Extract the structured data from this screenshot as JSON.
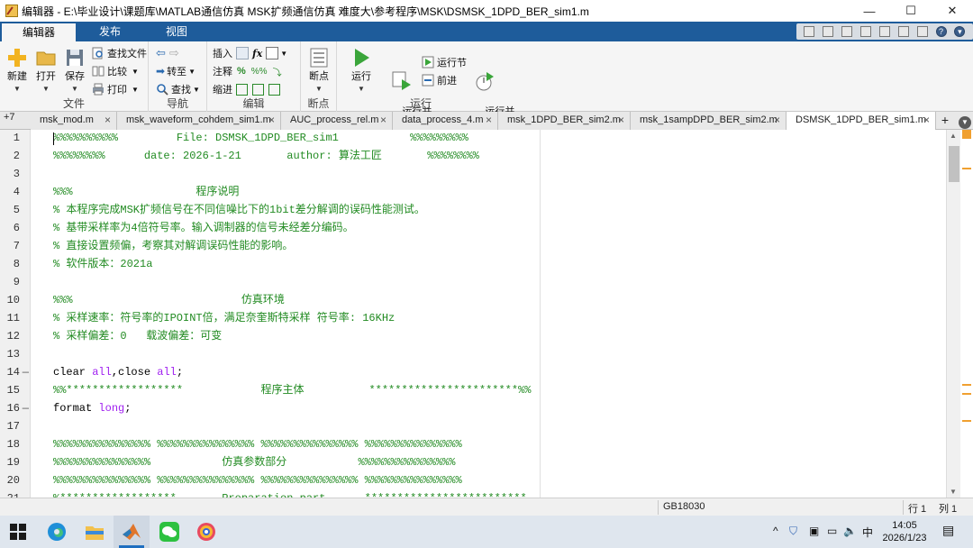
{
  "window": {
    "title": "编辑器 - E:\\毕业设计\\课题库\\MATLAB通信仿真 MSK扩频通信仿真 难度大\\参考程序\\MSK\\DSMSK_1DPD_BER_sim1.m",
    "minimize": "—",
    "maximize": "☐",
    "close": "✕"
  },
  "ribbon_tabs": [
    "编辑器",
    "发布",
    "视图"
  ],
  "ribbon": {
    "file": {
      "new": "新建",
      "open": "打开",
      "save": "保存",
      "find_files": "查找文件",
      "compare": "比较",
      "print": "打印",
      "label": "文件"
    },
    "navigate": {
      "goto": "转至",
      "find": "查找",
      "label": "导航"
    },
    "edit": {
      "insert": "插入",
      "comment": "注释",
      "indent": "缩进",
      "label": "编辑"
    },
    "breakpoints": {
      "button": "断点",
      "label": "断点"
    },
    "run": {
      "run": "运行",
      "run_advance": "运行并\n前进",
      "run_section": "运行节",
      "advance": "前进",
      "run_time": "运行并\n计时",
      "label": "运行"
    }
  },
  "doc_tabs": {
    "overflow": "+7",
    "tabs": [
      "msk_mod.m",
      "msk_waveform_cohdem_sim1.m",
      "AUC_process_rel.m",
      "data_process_4.m",
      "msk_1DPD_BER_sim2.m",
      "msk_1sampDPD_BER_sim2.m",
      "DSMSK_1DPD_BER_sim1.m"
    ],
    "active_index": 6,
    "close": "×",
    "add": "+"
  },
  "editor": {
    "line_numbers": [
      "1",
      "2",
      "3",
      "4",
      "5",
      "6",
      "7",
      "8",
      "9",
      "10",
      "11",
      "12",
      "13",
      "14",
      "15",
      "16",
      "17",
      "18",
      "19",
      "20",
      "21"
    ],
    "executable_lines": [
      "14",
      "16"
    ],
    "lines": [
      [
        {
          "t": "%%%%%%%%%%         File: DSMSK_1DPD_BER_sim1           %%%%%%%%%",
          "c": "cmt"
        }
      ],
      [
        {
          "t": "%%%%%%%%      date: 2026-1-21       author: 算法工匠       %%%%%%%%",
          "c": "cmt"
        }
      ],
      [],
      [
        {
          "t": "%%%                   程序说明",
          "c": "cmt"
        }
      ],
      [
        {
          "t": "% 本程序完成MSK扩频信号在不同信噪比下的1bit差分解调的误码性能测试。",
          "c": "cmt"
        }
      ],
      [
        {
          "t": "% 基带采样率为4倍符号率。输入调制器的信号未经差分编码。",
          "c": "cmt"
        }
      ],
      [
        {
          "t": "% 直接设置频偏，考察其对解调误码性能的影响。",
          "c": "cmt"
        }
      ],
      [
        {
          "t": "% 软件版本：2021a",
          "c": "cmt"
        }
      ],
      [],
      [
        {
          "t": "%%%                          仿真环境",
          "c": "cmt"
        }
      ],
      [
        {
          "t": "% 采样速率：符号率的IPOINT倍，满足奈奎斯特采样 符号率: 16KHz",
          "c": "cmt"
        }
      ],
      [
        {
          "t": "% 采样偏差：0   载波偏差：可变",
          "c": "cmt"
        }
      ],
      [],
      [
        {
          "t": "clear ",
          "c": ""
        },
        {
          "t": "all",
          "c": "kw"
        },
        {
          "t": ",close ",
          "c": ""
        },
        {
          "t": "all",
          "c": "kw"
        },
        {
          "t": ";",
          "c": ""
        }
      ],
      [
        {
          "t": "%%******************            程序主体          ***********************%%",
          "c": "cmt"
        }
      ],
      [
        {
          "t": "format ",
          "c": ""
        },
        {
          "t": "long",
          "c": "kw"
        },
        {
          "t": ";",
          "c": ""
        }
      ],
      [],
      [
        {
          "t": "%%%%%%%%%%%%%%% %%%%%%%%%%%%%%% %%%%%%%%%%%%%%% %%%%%%%%%%%%%%%",
          "c": "cmt"
        }
      ],
      [
        {
          "t": "%%%%%%%%%%%%%%%           仿真参数部分           %%%%%%%%%%%%%%%",
          "c": "cmt"
        }
      ],
      [
        {
          "t": "%%%%%%%%%%%%%%% %%%%%%%%%%%%%%% %%%%%%%%%%%%%%% %%%%%%%%%%%%%%%",
          "c": "cmt"
        }
      ],
      [
        {
          "t": "%******************       Preparation part      *************************",
          "c": "cmt"
        }
      ]
    ]
  },
  "status": {
    "encoding": "GB18030",
    "row": "行 1",
    "col": "列 1"
  },
  "taskbar": {
    "time": "14:05",
    "date": "2026/1/23",
    "ime": "中",
    "chevron": "^"
  },
  "colors": {
    "ribbon_blue": "#1e5c9b",
    "comment_green": "#228b22",
    "keyword_purple": "#a020f0"
  }
}
